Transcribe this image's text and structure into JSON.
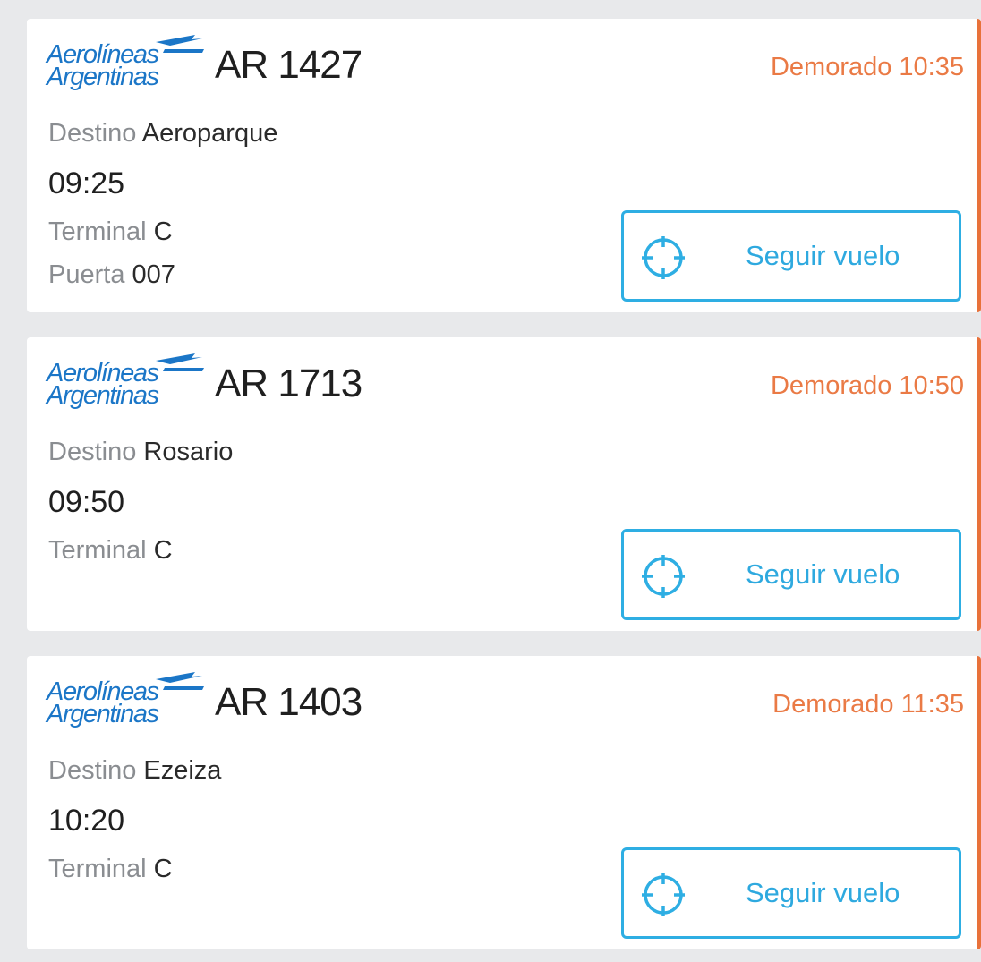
{
  "colors": {
    "brand_blue": "#1b76c7",
    "status_orange": "#ea7a45",
    "button_blue": "#2eaee3",
    "background": "#e8e9eb"
  },
  "flights": [
    {
      "airline_logo": "Aerolíneas\nArgentinas",
      "flight_number": "AR 1427",
      "status": "Demorado 10:35",
      "destination_label": "Destino",
      "destination": "Aeroparque",
      "time": "09:25",
      "terminal_label": "Terminal",
      "terminal": "C",
      "gate_label": "Puerta",
      "gate": "007",
      "follow_label": "Seguir vuelo",
      "follow_icon": "crosshair-icon"
    },
    {
      "airline_logo": "Aerolíneas\nArgentinas",
      "flight_number": "AR 1713",
      "status": "Demorado 10:50",
      "destination_label": "Destino",
      "destination": "Rosario",
      "time": "09:50",
      "terminal_label": "Terminal",
      "terminal": "C",
      "follow_label": "Seguir vuelo",
      "follow_icon": "crosshair-icon"
    },
    {
      "airline_logo": "Aerolíneas\nArgentinas",
      "flight_number": "AR 1403",
      "status": "Demorado 11:35",
      "destination_label": "Destino",
      "destination": "Ezeiza",
      "time": "10:20",
      "terminal_label": "Terminal",
      "terminal": "C",
      "follow_label": "Seguir vuelo",
      "follow_icon": "crosshair-icon"
    }
  ]
}
